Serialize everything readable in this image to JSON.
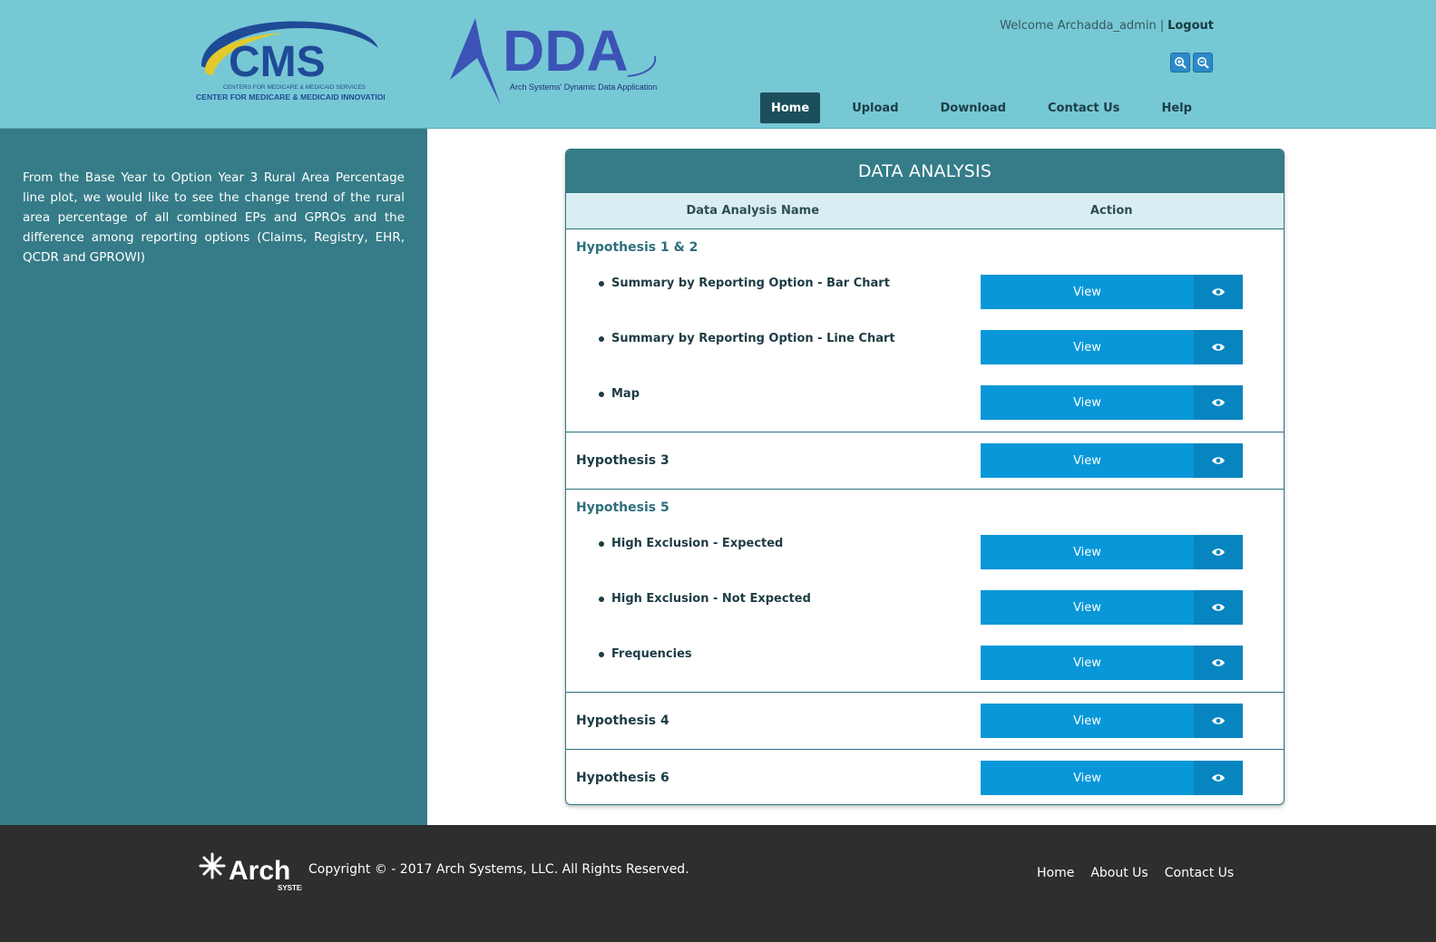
{
  "header": {
    "cms_logo": {
      "big_text": "CMS",
      "line1": "CENTERS FOR MEDICARE & MEDICAID SERVICES",
      "line2": "CENTER FOR MEDICARE & MEDICAID INNOVATION"
    },
    "adda_logo": {
      "big_text": "DDA",
      "tagline": "Arch Systems' Dynamic Data Application"
    },
    "welcome_text": "Welcome Archadda_admin",
    "separator": "|",
    "logout_label": "Logout",
    "zoom_in_icon": "zoom-in-icon",
    "zoom_out_icon": "zoom-out-icon",
    "nav": [
      {
        "label": "Home",
        "active": true
      },
      {
        "label": "Upload",
        "active": false
      },
      {
        "label": "Download",
        "active": false
      },
      {
        "label": "Contact Us",
        "active": false
      },
      {
        "label": "Help",
        "active": false
      }
    ],
    "background_color": "#77c8d5"
  },
  "sidebar": {
    "description": "From the Base Year to Option Year 3 Rural Area Percentage line plot, we would like to see the change trend of the rural area percentage of all combined EPs and GPROs and the difference among reporting options (Claims, Registry, EHR, QCDR and GPROWI)",
    "background_color": "#357c88"
  },
  "panel": {
    "title": "DATA ANALYSIS",
    "columns": {
      "name": "Data Analysis Name",
      "action": "Action"
    },
    "view_label": "View",
    "view_icon": "eye-icon",
    "groups": [
      {
        "title": "Hypothesis 1 & 2",
        "items": [
          "Summary by Reporting Option - Bar Chart",
          "Summary by Reporting Option - Line Chart",
          "Map"
        ]
      },
      {
        "title": "Hypothesis 3",
        "items": []
      },
      {
        "title": "Hypothesis 5",
        "items": [
          "High Exclusion - Expected",
          "High Exclusion - Not Expected",
          "Frequencies"
        ]
      },
      {
        "title": "Hypothesis 4",
        "items": []
      },
      {
        "title": "Hypothesis 6",
        "items": []
      }
    ],
    "button_color": "#0897d8"
  },
  "footer": {
    "logo_text": "Arch",
    "logo_subtext": "SYSTEMS",
    "copyright": "Copyright © - 2017 Arch Systems, LLC. All Rights Reserved.",
    "links": [
      "Home",
      "About Us",
      "Contact Us"
    ],
    "background_color": "#2e2e2e"
  }
}
